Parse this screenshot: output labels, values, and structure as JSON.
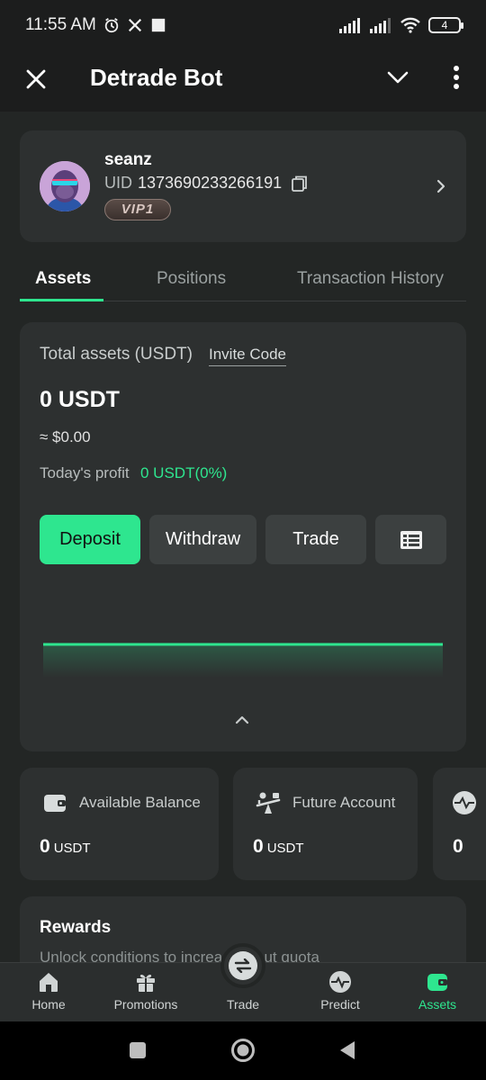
{
  "status_bar": {
    "time": "11:55 AM",
    "battery": "4"
  },
  "app_bar": {
    "title": "Detrade Bot"
  },
  "profile": {
    "username": "seanz",
    "uid_label": "UID",
    "uid_value": "1373690233266191",
    "vip_badge": "VIP1"
  },
  "tabs": [
    {
      "label": "Assets",
      "active": true
    },
    {
      "label": "Positions",
      "active": false
    },
    {
      "label": "Transaction History",
      "active": false
    }
  ],
  "assets": {
    "total_label": "Total assets (USDT)",
    "invite_code_label": "Invite Code",
    "total_value": "0 USDT",
    "approx_value": "≈ $0.00",
    "profit_label": "Today's profit",
    "profit_value": "0 USDT(0%)",
    "buttons": {
      "deposit": "Deposit",
      "withdraw": "Withdraw",
      "trade": "Trade"
    }
  },
  "balances": [
    {
      "title": "Available Balance",
      "amount": "0",
      "unit": "USDT",
      "icon": "wallet-icon"
    },
    {
      "title": "Future Account",
      "amount": "0",
      "unit": "USDT",
      "icon": "seesaw-icon"
    },
    {
      "title": "",
      "amount": "0",
      "unit": "",
      "icon": "pulse-icon"
    }
  ],
  "rewards": {
    "title": "Rewards",
    "description": "Unlock conditions to increa... shout quota"
  },
  "bottom_nav": [
    {
      "label": "Home",
      "icon": "home-icon",
      "active": false
    },
    {
      "label": "Promotions",
      "icon": "gift-icon",
      "active": false
    },
    {
      "label": "Trade",
      "icon": "swap-icon",
      "active": false
    },
    {
      "label": "Predict",
      "icon": "pulse-icon",
      "active": false
    },
    {
      "label": "Assets",
      "icon": "wallet-icon",
      "active": true
    }
  ],
  "colors": {
    "accent": "#2ee68f",
    "background": "#232625",
    "card": "#2d3030"
  }
}
